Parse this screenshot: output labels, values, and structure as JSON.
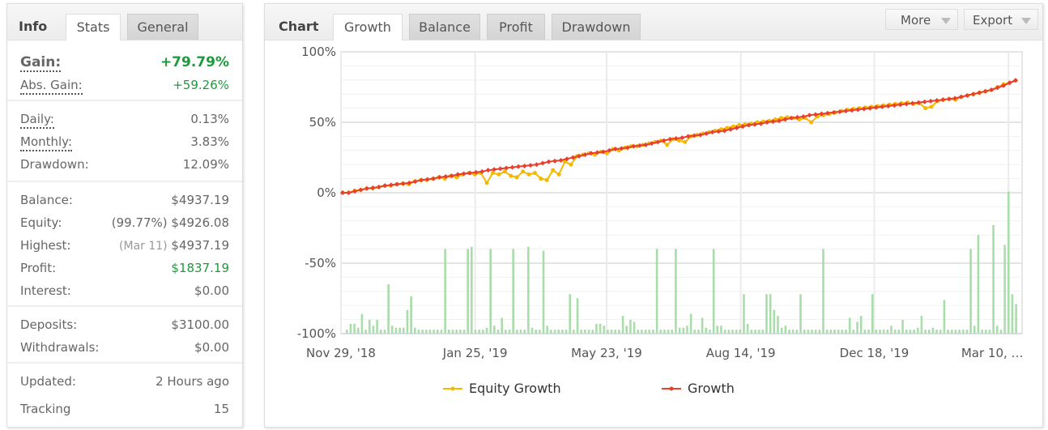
{
  "info_panel": {
    "title": "Info",
    "tabs": [
      {
        "label": "Stats",
        "active": true
      },
      {
        "label": "General",
        "active": false
      }
    ],
    "gain": {
      "label": "Gain:",
      "value": "+79.79%"
    },
    "abs_gain": {
      "label": "Abs. Gain:",
      "value": "+59.26%"
    },
    "daily": {
      "label": "Daily:",
      "value": "0.13%"
    },
    "monthly": {
      "label": "Monthly:",
      "value": "3.83%"
    },
    "drawdown": {
      "label": "Drawdown:",
      "value": "12.09%"
    },
    "balance": {
      "label": "Balance:",
      "value": "$4937.19"
    },
    "equity": {
      "label": "Equity:",
      "note": "(99.77%)",
      "value": "$4926.08"
    },
    "highest": {
      "label": "Highest:",
      "note": "(Mar 11)",
      "value": "$4937.19"
    },
    "profit": {
      "label": "Profit:",
      "value": "$1837.19"
    },
    "interest": {
      "label": "Interest:",
      "value": "$0.00"
    },
    "deposits": {
      "label": "Deposits:",
      "value": "$3100.00"
    },
    "withdrawals": {
      "label": "Withdrawals:",
      "value": "$0.00"
    },
    "updated": {
      "label": "Updated:",
      "value": "2 Hours ago"
    },
    "tracking": {
      "label": "Tracking",
      "value": "15"
    }
  },
  "chart_panel": {
    "title": "Chart",
    "tabs": [
      {
        "label": "Growth",
        "active": true
      },
      {
        "label": "Balance",
        "active": false
      },
      {
        "label": "Profit",
        "active": false
      },
      {
        "label": "Drawdown",
        "active": false
      }
    ],
    "buttons": {
      "more": "More",
      "export": "Export"
    }
  },
  "colors": {
    "gain_green": "#1a9c3a",
    "growth": "#e8402e",
    "equity": "#f5b800",
    "bars": "#a8dca8"
  },
  "chart_data": {
    "type": "line",
    "title": "",
    "xlabel": "",
    "ylabel": "",
    "ylim": [
      -100,
      100
    ],
    "y_ticks": [
      "100%",
      "50%",
      "0%",
      "-50%",
      "-100%"
    ],
    "y_tick_values": [
      100,
      50,
      0,
      -50,
      -100
    ],
    "x_tick_labels": [
      "Nov 29, '18",
      "Jan 25, '19",
      "May 23, '19",
      "Aug 14, '19",
      "Dec 18, '19",
      "Mar 10, …"
    ],
    "grid": true,
    "legend": {
      "placement": "bottom",
      "entries": [
        {
          "name": "Equity Growth",
          "color": "#f5b800"
        },
        {
          "name": "Growth",
          "color": "#e8402e"
        }
      ]
    },
    "series": [
      {
        "name": "Growth",
        "values": [
          0,
          0,
          1,
          2,
          3,
          3.5,
          4,
          5,
          5.5,
          6,
          6.5,
          7,
          8,
          9,
          9.5,
          10,
          11,
          11.5,
          12,
          13,
          13.5,
          14,
          14.5,
          15,
          16,
          16.5,
          17,
          17.5,
          18,
          18.5,
          19,
          19.5,
          20,
          21,
          22,
          22.5,
          23,
          24,
          25,
          26,
          27,
          28,
          28.5,
          29,
          30,
          31,
          31.5,
          32,
          33,
          33.5,
          34,
          35,
          36,
          37,
          38,
          38.5,
          39,
          40,
          40.5,
          41,
          42,
          43,
          43.5,
          44,
          45,
          46,
          47,
          48,
          48.5,
          49,
          50,
          50.5,
          51,
          52,
          53,
          53.5,
          54,
          55,
          55.5,
          56,
          56.5,
          57,
          57.5,
          58,
          58.5,
          59,
          59.5,
          60,
          60.5,
          61,
          61.5,
          62,
          62.5,
          63,
          63.5,
          64,
          64.5,
          65,
          65.5,
          66,
          66.5,
          67,
          68,
          69,
          70,
          71,
          72,
          73,
          74.5,
          76,
          78,
          79.79
        ]
      },
      {
        "name": "Equity Growth",
        "values": [
          0,
          0,
          1.5,
          2,
          3,
          3,
          4,
          5,
          5,
          6,
          6.5,
          6,
          8,
          9,
          9,
          10,
          11,
          10,
          12,
          11,
          13,
          14,
          13,
          14,
          7,
          14,
          13,
          15,
          12,
          11,
          15,
          13,
          14,
          10,
          9,
          16,
          13,
          22,
          20,
          26,
          27,
          28,
          27,
          29,
          28,
          31,
          30,
          32,
          33,
          33,
          34,
          35,
          36,
          37,
          34,
          38,
          37,
          36,
          40,
          41,
          42,
          43,
          44,
          45,
          46,
          47,
          48,
          48.5,
          49,
          50,
          50.5,
          51,
          52,
          53,
          53.5,
          53,
          52,
          53,
          50,
          54,
          55,
          56,
          57,
          58,
          59,
          59.5,
          60,
          60.5,
          61,
          61.5,
          62,
          62.5,
          63,
          63.5,
          64,
          63,
          63.5,
          60,
          61,
          65,
          66,
          66.5,
          66,
          68,
          69,
          70,
          71,
          72,
          73,
          75,
          77,
          78,
          79.5
        ]
      },
      {
        "name": "Daily Bars",
        "values": [
          2,
          5,
          5,
          3,
          10,
          2,
          7,
          4,
          7,
          2,
          2,
          25,
          4,
          3,
          3,
          3,
          12,
          19,
          3,
          2,
          2,
          2,
          2,
          2,
          2,
          2,
          43,
          2,
          2,
          2,
          2,
          2,
          43,
          44,
          2,
          2,
          2,
          3,
          43,
          4,
          2,
          8,
          2,
          2,
          43,
          2,
          2,
          2,
          44,
          3,
          2,
          2,
          42,
          4,
          2,
          2,
          2,
          2,
          2,
          20,
          2,
          18,
          2,
          2,
          2,
          2,
          5,
          5,
          4,
          2,
          2,
          2,
          2,
          9,
          4,
          7,
          6,
          2,
          2,
          2,
          2,
          2,
          43,
          2,
          2,
          2,
          2,
          43,
          3,
          3,
          4,
          10,
          2,
          2,
          8,
          3,
          2,
          43,
          4,
          4,
          2,
          2,
          2,
          2,
          2,
          20,
          5,
          2,
          2,
          2,
          2,
          20,
          20,
          12,
          9,
          3,
          4,
          2,
          2,
          2,
          20,
          2,
          2,
          2,
          2,
          2,
          43,
          2,
          2,
          2,
          2,
          2,
          2,
          8,
          2,
          6,
          9,
          2,
          2,
          20,
          2,
          2,
          2,
          2,
          4,
          2,
          2,
          7,
          2,
          2,
          2,
          3,
          9,
          2,
          2,
          3,
          2,
          2,
          17,
          2,
          2,
          2,
          2,
          2,
          2,
          43,
          4,
          50,
          2,
          2,
          2,
          55,
          4,
          2,
          45,
          72,
          20,
          15
        ]
      }
    ]
  }
}
